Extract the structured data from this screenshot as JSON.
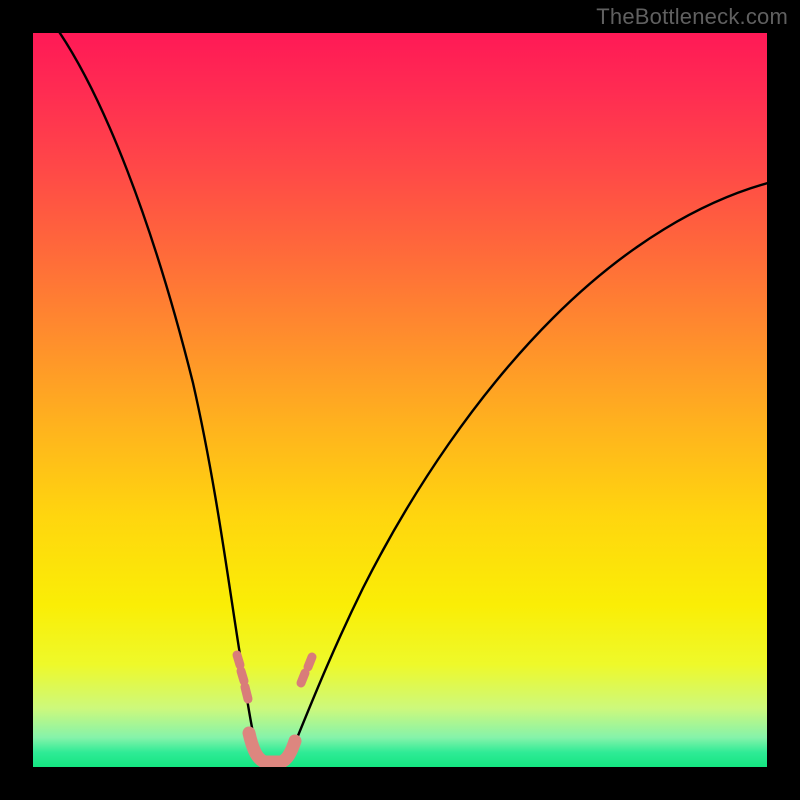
{
  "watermark": "TheBottleneck.com",
  "chart_data": {
    "type": "line",
    "title": "",
    "subtitle": "",
    "xlabel": "",
    "ylabel": "",
    "xlim": [
      0,
      100
    ],
    "ylim": [
      0,
      100
    ],
    "grid": false,
    "legend": false,
    "background": "rainbow-gradient vertical, red(top)→green(bottom)",
    "annotations": [
      {
        "text": "TheBottleneck.com",
        "position": "top-right",
        "color": "#606060"
      }
    ],
    "series": [
      {
        "name": "bottleneck-curve",
        "color": "#000000",
        "strokeWidth": 2,
        "description": "Two smooth arms descending from top toward a narrow V near x≈30, touching y≈0 (green band).",
        "points": [
          {
            "x": 4,
            "y": 100
          },
          {
            "x": 10,
            "y": 87
          },
          {
            "x": 15,
            "y": 72
          },
          {
            "x": 20,
            "y": 52
          },
          {
            "x": 24,
            "y": 30
          },
          {
            "x": 27,
            "y": 10
          },
          {
            "x": 29,
            "y": 2
          },
          {
            "x": 30,
            "y": 0
          },
          {
            "x": 33,
            "y": 0
          },
          {
            "x": 35,
            "y": 3
          },
          {
            "x": 38,
            "y": 10
          },
          {
            "x": 45,
            "y": 26
          },
          {
            "x": 55,
            "y": 42
          },
          {
            "x": 65,
            "y": 54
          },
          {
            "x": 75,
            "y": 62
          },
          {
            "x": 85,
            "y": 70
          },
          {
            "x": 95,
            "y": 75
          },
          {
            "x": 100,
            "y": 77
          }
        ]
      },
      {
        "name": "left-markers",
        "color": "#d97c7a",
        "description": "Short salmon dashes at lower section of left arm (in yellow band).",
        "points": [
          {
            "x": 25.5,
            "y": 13
          },
          {
            "x": 26.0,
            "y": 11
          },
          {
            "x": 26.5,
            "y": 9
          }
        ]
      },
      {
        "name": "right-markers",
        "color": "#d97c7a",
        "description": "Short salmon dashes at lower section of right arm (in yellow band).",
        "points": [
          {
            "x": 35.5,
            "y": 11
          },
          {
            "x": 36.2,
            "y": 13
          }
        ]
      },
      {
        "name": "bottom-band",
        "color": "#dd867f",
        "description": "Thick salmon segment at base of V lying on green band.",
        "points": [
          {
            "x": 28.5,
            "y": 1.2
          },
          {
            "x": 34.5,
            "y": 1.2
          }
        ]
      }
    ]
  }
}
